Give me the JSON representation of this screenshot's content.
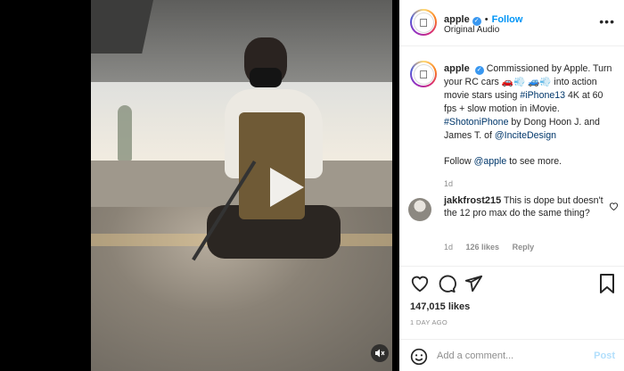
{
  "header": {
    "username": "apple",
    "follow_label": "Follow",
    "subtitle": "Original Audio",
    "more_label": "•••"
  },
  "caption": {
    "username": "apple",
    "text_1": "Commissioned by Apple. Turn your RC cars 🚗💨 🚙💨 into action movie stars using ",
    "tag_1": "#iPhone13",
    "text_2": " 4K at 60 fps + slow motion in iMovie. ",
    "tag_2": "#ShotoniPhone",
    "text_3": " by Dong Hoon J. and James T. of ",
    "tag_3": "@InciteDesign",
    "follow_pre": "Follow ",
    "follow_tag": "@apple",
    "follow_post": " to see more.",
    "age": "1d"
  },
  "comment": {
    "username": "jakkfrost215",
    "text": "This is dope but doesn't the 12 pro max do the same thing?",
    "age": "1d",
    "likes": "126 likes",
    "reply_label": "Reply"
  },
  "stats": {
    "likes": "147,015 likes",
    "posted": "1 DAY AGO"
  },
  "composer": {
    "placeholder": "Add a comment...",
    "post_label": "Post"
  },
  "colors": {
    "link": "#0095f6",
    "tag": "#00376b",
    "verified": "#3897f0"
  }
}
